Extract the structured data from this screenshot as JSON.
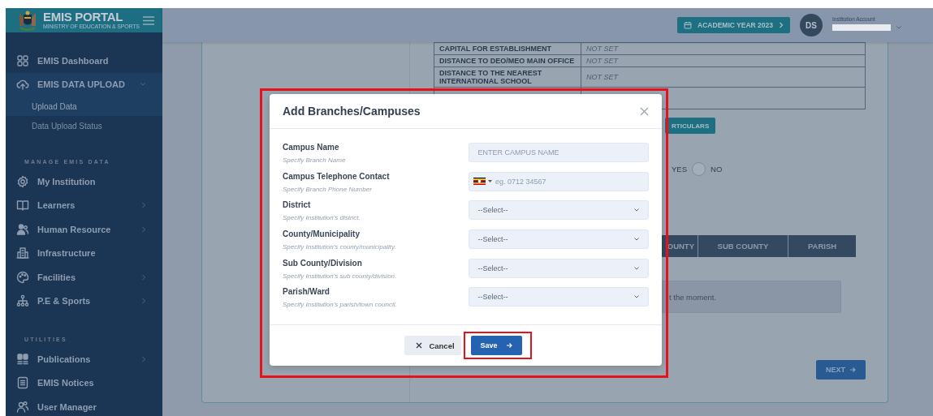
{
  "brand": {
    "title": "EMIS PORTAL",
    "subtitle": "MINISTRY OF EDUCATION & SPORTS"
  },
  "sidebar": {
    "items": [
      {
        "kind": "link",
        "label": "EMIS Dashboard",
        "has_submenu": false,
        "selected": false
      },
      {
        "kind": "link",
        "label": "EMIS DATA UPLOAD",
        "has_submenu": true,
        "expanded": true,
        "selected": true,
        "children": [
          {
            "label": "Upload Data",
            "selected": true
          },
          {
            "label": "Data Upload Status",
            "selected": false
          }
        ]
      },
      {
        "kind": "section",
        "label": "MANAGE EMIS DATA"
      },
      {
        "kind": "link",
        "label": "My Institution",
        "has_submenu": false,
        "selected": false
      },
      {
        "kind": "link",
        "label": "Learners",
        "has_submenu": true,
        "expanded": false,
        "selected": false
      },
      {
        "kind": "link",
        "label": "Human Resource",
        "has_submenu": true,
        "expanded": false,
        "selected": false
      },
      {
        "kind": "link",
        "label": "Infrastructure",
        "has_submenu": false,
        "selected": false
      },
      {
        "kind": "link",
        "label": "Facilities",
        "has_submenu": true,
        "expanded": false,
        "selected": false
      },
      {
        "kind": "link",
        "label": "P.E & Sports",
        "has_submenu": true,
        "expanded": false,
        "selected": false
      },
      {
        "kind": "section",
        "label": "UTILITIES"
      },
      {
        "kind": "link",
        "label": "Publications",
        "has_submenu": true,
        "expanded": false,
        "selected": false
      },
      {
        "kind": "link",
        "label": "EMIS Notices",
        "has_submenu": false,
        "selected": false
      },
      {
        "kind": "link",
        "label": "User Manager",
        "has_submenu": false,
        "selected": false
      }
    ]
  },
  "header": {
    "academic_year": "ACADEMIC YEAR 2023",
    "avatar": "DS",
    "account_label": "Institution Account"
  },
  "details_table": {
    "rows": [
      {
        "label": "CAPITAL FOR ESTABLISHMENT",
        "value": "NOT SET"
      },
      {
        "label": "DISTANCE TO DEO/MEO MAIN OFFICE",
        "value": "NOT SET"
      },
      {
        "label": "DISTANCE TO THE NEAREST INTERNATIONAL SCHOOL",
        "value": "NOT SET"
      }
    ]
  },
  "particulars_button": "RTICULARS",
  "radio_options": [
    {
      "label": "YES"
    },
    {
      "label": "NO",
      "selected": false
    }
  ],
  "branches_table": {
    "columns": [
      "OUNTY",
      "SUB COUNTY",
      "PARISH"
    ],
    "empty_message": "t the moment."
  },
  "next_button": "NEXT",
  "modal": {
    "title": "Add Branches/Campuses",
    "fields": [
      {
        "kind": "text",
        "label": "Campus Name",
        "hint": "Specify Branch Name",
        "placeholder": "ENTER CAMPUS NAME"
      },
      {
        "kind": "phone",
        "label": "Campus Telephone Contact",
        "hint": "Specify Branch Phone Number",
        "placeholder": "eg. 0712 34567"
      },
      {
        "kind": "select",
        "label": "District",
        "hint": "Specify Institution's district.",
        "value": "--Select--"
      },
      {
        "kind": "select",
        "label": "County/Municipality",
        "hint": "Specify Institution's county/municipality.",
        "value": "--Select--"
      },
      {
        "kind": "select",
        "label": "Sub County/Division",
        "hint": "Specify Institution's sub county/division.",
        "value": "--Select--"
      },
      {
        "kind": "select",
        "label": "Parish/Ward",
        "hint": "Specify Institution's parish/town council.",
        "value": "--Select--"
      }
    ],
    "cancel_button": "Cancel",
    "save_button": "Save"
  }
}
